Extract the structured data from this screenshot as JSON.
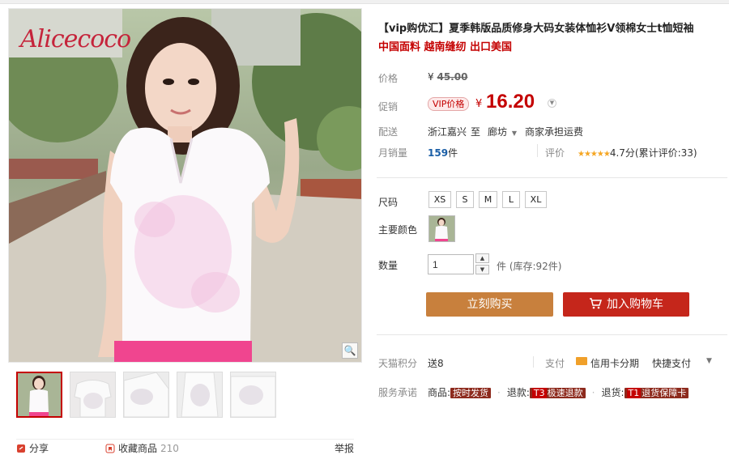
{
  "gallery": {
    "brand": "Alicecoco",
    "zoom_icon": "magnifier-icon",
    "thumbnails": [
      "thumb-front",
      "thumb-back-1",
      "thumb-back-2",
      "thumb-back-3",
      "thumb-back-4"
    ]
  },
  "share": {
    "share_label": "分享",
    "favorite_label": "收藏商品",
    "favorite_count": "210",
    "report_label": "举报"
  },
  "product": {
    "title": "【vip购优汇】夏季韩版品质修身大码女装体恤衫V领棉女士t恤短袖",
    "subtitle": "中国面料 越南缝纫 出口美国"
  },
  "price": {
    "label": "价格",
    "currency": "¥",
    "original": "45.00",
    "promo_label": "促销",
    "vip_badge": "VIP价格",
    "promo_value": "16.20"
  },
  "delivery": {
    "label": "配送",
    "from": "浙江嘉兴",
    "to_word": "至",
    "to": "廊坊",
    "fee": "商家承担运费"
  },
  "sales": {
    "label": "月销量",
    "count": "159",
    "unit": "件",
    "review_label": "评价",
    "rating": "4.7分",
    "review_count": "(累计评价:33)",
    "stars_filled": 5
  },
  "options": {
    "size_label": "尺码",
    "sizes": [
      "XS",
      "S",
      "M",
      "L",
      "XL"
    ],
    "color_label": "主要颜色",
    "qty_label": "数量",
    "qty_value": "1",
    "stock_text": "件 (库存:92件)"
  },
  "actions": {
    "buy_now": "立刻购买",
    "add_cart": "加入购物车"
  },
  "payment": {
    "points_label": "天猫积分",
    "points_value": "送8",
    "pay_label": "支付",
    "credit_label": "信用卡分期",
    "quick_pay": "快捷支付"
  },
  "service": {
    "label": "服务承诺",
    "goods_label": "商品:",
    "goods_tag": "按时发货",
    "refund_label": "退款:",
    "refund_code": "T3",
    "refund_tag": "极速退款",
    "return_label": "退货:",
    "return_code": "T1",
    "return_tag": "退货保障卡"
  },
  "colors": {
    "accent_red": "#c40000",
    "buy_orange": "#c8803d",
    "cart_red": "#c5261b",
    "pink_accent": "#f0458f"
  }
}
